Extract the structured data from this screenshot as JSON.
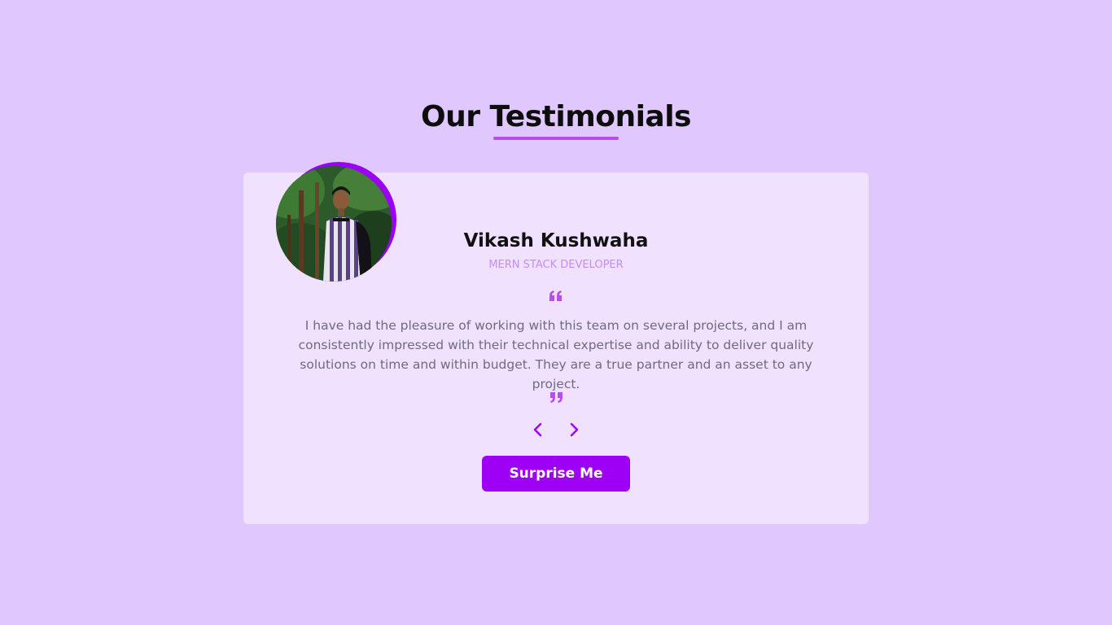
{
  "header": {
    "title": "Our Testimonials"
  },
  "testimonial": {
    "name": "Vikash Kushwaha",
    "role": "MERN STACK DEVELOPER",
    "text": "I have had the pleasure of working with this team on several projects, and I am consistently impressed with their technical expertise and ability to deliver quality solutions on time and within budget. They are a true partner and an asset to any project.",
    "avatar_alt": "Vikash Kushwaha"
  },
  "controls": {
    "prev_icon": "chevron-left-icon",
    "next_icon": "chevron-right-icon",
    "surprise_label": "Surprise Me"
  },
  "colors": {
    "background": "#e0c8ff",
    "card": "#f0e2ff",
    "accent": "#9d00f5",
    "underline": "#b84cf0",
    "role": "#c58cf0"
  }
}
